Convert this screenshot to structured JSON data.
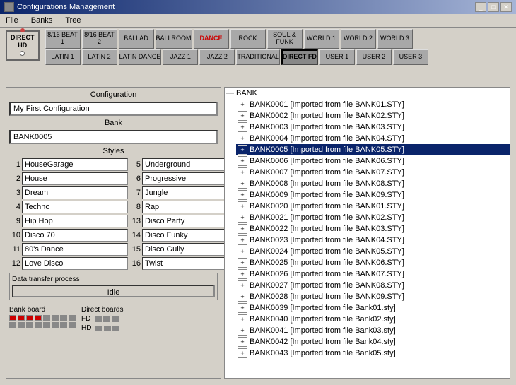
{
  "window": {
    "title": "Configurations Management",
    "menu": [
      "File",
      "Banks",
      "Tree"
    ]
  },
  "keyboard": {
    "top_buttons": [
      {
        "label": "8/16 BEAT\n1",
        "active": false
      },
      {
        "label": "8/16 BEAT\n2",
        "active": false
      },
      {
        "label": "BALLAD",
        "active": false
      },
      {
        "label": "BALLROOM",
        "active": false
      },
      {
        "label": "DANCE",
        "active": true,
        "highlighted": true
      },
      {
        "label": "ROCK",
        "active": false
      },
      {
        "label": "SOUL &\nFUNK",
        "active": false
      },
      {
        "label": "WORLD 1",
        "active": false
      },
      {
        "label": "WORLD 2",
        "active": false
      },
      {
        "label": "WORLD 3",
        "active": false
      }
    ],
    "bottom_buttons": [
      {
        "label": "LATIN 1"
      },
      {
        "label": "LATIN 2"
      },
      {
        "label": "LATIN DANCE"
      },
      {
        "label": "JAZZ 1"
      },
      {
        "label": "JAZZ 2"
      },
      {
        "label": "TRADITIONAL"
      },
      {
        "label": "DIRECT FD",
        "active": true
      },
      {
        "label": "USER 1"
      },
      {
        "label": "USER 2"
      },
      {
        "label": "USER 3"
      }
    ]
  },
  "left_panel": {
    "config_label": "Configuration",
    "config_value": "My First Configuration",
    "bank_label": "Bank",
    "bank_value": "BANK0005",
    "styles_label": "Styles",
    "styles": [
      {
        "num": "1",
        "name": "HouseGarage"
      },
      {
        "num": "2",
        "name": "House"
      },
      {
        "num": "3",
        "name": "Dream"
      },
      {
        "num": "4",
        "name": "Techno"
      },
      {
        "num": "9",
        "name": "Hip Hop"
      },
      {
        "num": "10",
        "name": "Disco 70"
      },
      {
        "num": "11",
        "name": "80's Dance"
      },
      {
        "num": "12",
        "name": "Love Disco"
      },
      {
        "num": "5",
        "name": "Underground"
      },
      {
        "num": "6",
        "name": "Progressive"
      },
      {
        "num": "7",
        "name": "Jungle"
      },
      {
        "num": "8",
        "name": "Rap"
      },
      {
        "num": "13",
        "name": "Disco Party"
      },
      {
        "num": "14",
        "name": "Disco Funky"
      },
      {
        "num": "15",
        "name": "Disco Gully"
      },
      {
        "num": "16",
        "name": "Twist"
      }
    ],
    "data_transfer_title": "Data transfer process",
    "idle_label": "Idle",
    "bank_board_label": "Bank board",
    "direct_boards_label": "Direct boards",
    "fd_label": "FD",
    "hd_label": "HD"
  },
  "tree": {
    "root_label": "BANK",
    "items": [
      {
        "id": "BANK0001",
        "label": "BANK0001 [Imported from file BANK01.STY]",
        "selected": false
      },
      {
        "id": "BANK0002",
        "label": "BANK0002 [Imported from file BANK02.STY]",
        "selected": false
      },
      {
        "id": "BANK0003",
        "label": "BANK0003 [Imported from file BANK03.STY]",
        "selected": false
      },
      {
        "id": "BANK0004",
        "label": "BANK0004 [Imported from file BANK04.STY]",
        "selected": false
      },
      {
        "id": "BANK0005",
        "label": "BANK0005 [Imported from file BANK05.STY]",
        "selected": true
      },
      {
        "id": "BANK0006",
        "label": "BANK0006 [Imported from file BANK06.STY]",
        "selected": false
      },
      {
        "id": "BANK0007",
        "label": "BANK0007 [Imported from file BANK07.STY]",
        "selected": false
      },
      {
        "id": "BANK0008",
        "label": "BANK0008 [Imported from file BANK08.STY]",
        "selected": false
      },
      {
        "id": "BANK0009",
        "label": "BANK0009 [Imported from file BANK09.STY]",
        "selected": false
      },
      {
        "id": "BANK0020",
        "label": "BANK0020 [Imported from file BANK01.STY]",
        "selected": false
      },
      {
        "id": "BANK0021",
        "label": "BANK0021 [Imported from file BANK02.STY]",
        "selected": false
      },
      {
        "id": "BANK0022",
        "label": "BANK0022 [Imported from file BANK03.STY]",
        "selected": false
      },
      {
        "id": "BANK0023",
        "label": "BANK0023 [Imported from file BANK04.STY]",
        "selected": false
      },
      {
        "id": "BANK0024",
        "label": "BANK0024 [Imported from file BANK05.STY]",
        "selected": false
      },
      {
        "id": "BANK0025",
        "label": "BANK0025 [Imported from file BANK06.STY]",
        "selected": false
      },
      {
        "id": "BANK0026",
        "label": "BANK0026 [Imported from file BANK07.STY]",
        "selected": false
      },
      {
        "id": "BANK0027",
        "label": "BANK0027 [Imported from file BANK08.STY]",
        "selected": false
      },
      {
        "id": "BANK0028",
        "label": "BANK0028 [Imported from file BANK09.STY]",
        "selected": false
      },
      {
        "id": "BANK0039",
        "label": "BANK0039 [Imported from file Bank01.sty]",
        "selected": false
      },
      {
        "id": "BANK0040",
        "label": "BANK0040 [Imported from file Bank02.sty]",
        "selected": false
      },
      {
        "id": "BANK0041",
        "label": "BANK0041 [Imported from file Bank03.sty]",
        "selected": false
      },
      {
        "id": "BANK0042",
        "label": "BANK0042 [Imported from file Bank04.sty]",
        "selected": false
      },
      {
        "id": "BANK0043",
        "label": "BANK0043 [Imported from file Bank05.sty]",
        "selected": false
      }
    ]
  }
}
